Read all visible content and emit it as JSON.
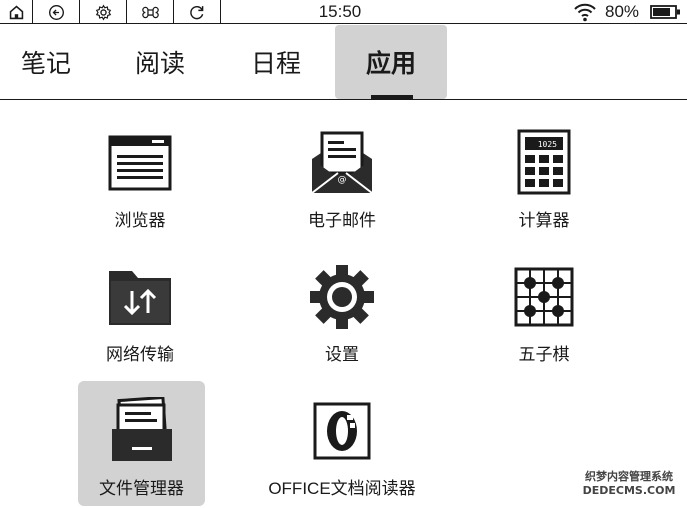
{
  "status_bar": {
    "buttons": [
      {
        "name": "home",
        "icon": "home-icon"
      },
      {
        "name": "back",
        "icon": "back-arrow-icon"
      },
      {
        "name": "settings",
        "icon": "gear-icon"
      },
      {
        "name": "apps",
        "icon": "command-icon"
      },
      {
        "name": "refresh",
        "icon": "refresh-icon"
      }
    ],
    "time": "15:50",
    "battery": "80%"
  },
  "tabs": [
    {
      "label": "笔记",
      "active": false
    },
    {
      "label": "阅读",
      "active": false
    },
    {
      "label": "日程",
      "active": false
    },
    {
      "label": "应用",
      "active": true
    }
  ],
  "apps": [
    {
      "label": "浏览器",
      "icon": "browser-icon"
    },
    {
      "label": "电子邮件",
      "icon": "email-icon"
    },
    {
      "label": "计算器",
      "icon": "calculator-icon",
      "display": "1025"
    },
    {
      "label": "网络传输",
      "icon": "network-transfer-icon"
    },
    {
      "label": "设置",
      "icon": "settings-gear-icon"
    },
    {
      "label": "五子棋",
      "icon": "gomoku-icon"
    },
    {
      "label": "文件管理器",
      "icon": "file-manager-icon",
      "selected": true
    },
    {
      "label": "OFFICE文档阅读器",
      "icon": "office-reader-icon"
    }
  ],
  "watermark": {
    "line1": "织梦内容管理系统",
    "line2": "DEDECMS.COM"
  }
}
